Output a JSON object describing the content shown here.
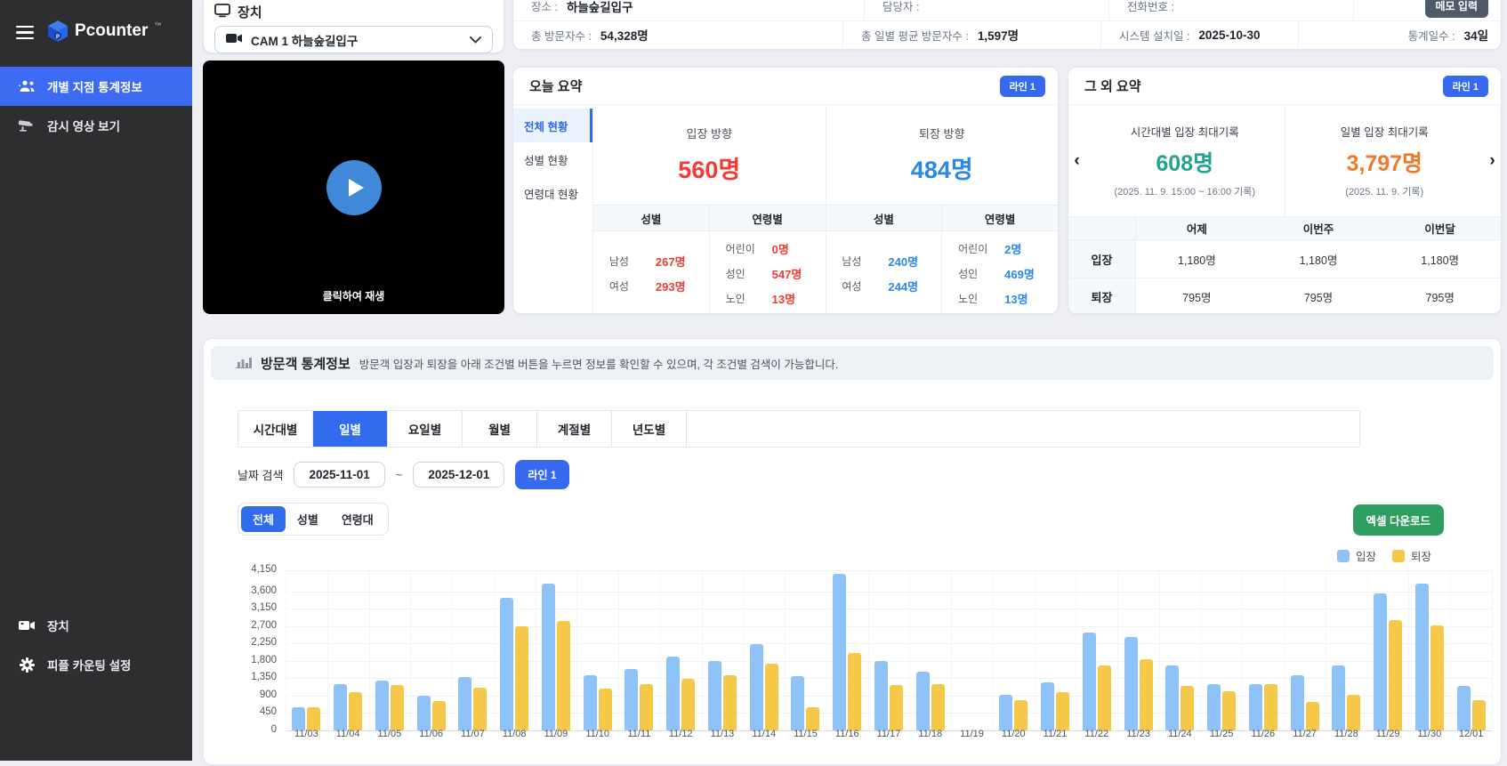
{
  "sidebar": {
    "logo": "Pcounter",
    "logo_tm": "™",
    "items": [
      {
        "label": "개별 지점 통계정보",
        "icon": "people-group-icon",
        "active": true
      },
      {
        "label": "감시 영상 보기",
        "icon": "cctv-camera-icon",
        "active": false
      }
    ],
    "bottom_items": [
      {
        "label": "장치",
        "icon": "video-camera-icon"
      },
      {
        "label": "피플 카운팅 설정",
        "icon": "gear-icon"
      }
    ]
  },
  "device": {
    "title": "장치",
    "selected": "CAM 1 하늘숲길입구"
  },
  "video": {
    "caption": "클릭하여 재생"
  },
  "info": {
    "row1": [
      {
        "label": "장소 :",
        "value": "하늘숲길입구"
      },
      {
        "label": "담당자 :",
        "value": ""
      },
      {
        "label": "전화번호 :",
        "value": ""
      }
    ],
    "memo_button": "메모 입력",
    "row2": [
      {
        "label": "총 방문자수 :",
        "value": "54,328명"
      },
      {
        "label": "총 일별 평균 방문자수 :",
        "value": "1,597명"
      },
      {
        "label": "시스템 설치일 :",
        "value": "2025-10-30"
      },
      {
        "label": "통계일수 :",
        "value": "34일"
      }
    ]
  },
  "today": {
    "title": "오늘 요약",
    "badge": "라인 1",
    "tabs": [
      "전체 현황",
      "성별 현황",
      "연령대 현황"
    ],
    "active_tab": "전체 현황",
    "entry": {
      "label": "입장 방향",
      "value": "560명"
    },
    "exit": {
      "label": "퇴장 방향",
      "value": "484명"
    },
    "col_headers": [
      "성별",
      "연령별",
      "성별",
      "연령별"
    ],
    "entry_gender": [
      {
        "label": "남성",
        "value": "267명"
      },
      {
        "label": "여성",
        "value": "293명"
      }
    ],
    "entry_age": [
      {
        "label": "어린이",
        "value": "0명"
      },
      {
        "label": "성인",
        "value": "547명"
      },
      {
        "label": "노인",
        "value": "13명"
      }
    ],
    "exit_gender": [
      {
        "label": "남성",
        "value": "240명"
      },
      {
        "label": "여성",
        "value": "244명"
      }
    ],
    "exit_age": [
      {
        "label": "어린이",
        "value": "2명"
      },
      {
        "label": "성인",
        "value": "469명"
      },
      {
        "label": "노인",
        "value": "13명"
      }
    ]
  },
  "other": {
    "title": "그 외 요약",
    "badge": "라인 1",
    "prev": "‹",
    "next": "›",
    "cards": [
      {
        "label": "시간대별 입장 최대기록",
        "value": "608명",
        "note": "(2025. 11. 9. 15:00 ~ 16:00 기록)",
        "color": "#22a390"
      },
      {
        "label": "일별 입장 최대기록",
        "value": "3,797명",
        "note": "(2025. 11. 9. 기록)",
        "color": "#f0782a"
      }
    ],
    "table": {
      "headers": [
        "어제",
        "이번주",
        "이번달"
      ],
      "rows": [
        {
          "label": "입장",
          "values": [
            "1,180명",
            "1,180명",
            "1,180명"
          ]
        },
        {
          "label": "퇴장",
          "values": [
            "795명",
            "795명",
            "795명"
          ]
        }
      ]
    }
  },
  "stats": {
    "title": "방문객 통계정보",
    "desc": "방문객 입장과 퇴장을 아래 조건별 버튼을 누르면 정보를 확인할 수 있으며, 각 조건별 검색이 가능합니다.",
    "tabs": [
      "시간대별",
      "일별",
      "요일별",
      "월별",
      "계절별",
      "년도별"
    ],
    "active_tab": "일별",
    "date_label": "날짜 검색",
    "date_from": "2025-11-01",
    "date_tilde": "~",
    "date_to": "2025-12-01",
    "line_button": "라인 1",
    "filters": [
      "전체",
      "성별",
      "연령대"
    ],
    "active_filter": "전체",
    "excel_button": "엑셀 다운로드"
  },
  "chart_data": {
    "type": "bar",
    "title": "",
    "xlabel": "",
    "ylabel": "",
    "categories": [
      "11/03",
      "11/04",
      "11/05",
      "11/06",
      "11/07",
      "11/08",
      "11/09",
      "11/10",
      "11/11",
      "11/12",
      "11/13",
      "11/14",
      "11/15",
      "11/16",
      "11/17",
      "11/18",
      "11/19",
      "11/20",
      "11/21",
      "11/22",
      "11/23",
      "11/24",
      "11/25",
      "11/26",
      "11/27",
      "11/28",
      "11/29",
      "11/30",
      "12/01"
    ],
    "series": [
      {
        "name": "입장",
        "color": "#8fc3f8",
        "values": [
          590,
          1190,
          1290,
          910,
          1380,
          3430,
          3797,
          1420,
          1580,
          1920,
          1800,
          2240,
          1410,
          4050,
          1800,
          1530,
          0,
          925,
          1250,
          2540,
          2410,
          1685,
          1190,
          1210,
          1420,
          1680,
          3560,
          3810,
          1150
        ]
      },
      {
        "name": "퇴장",
        "color": "#f6c84a",
        "values": [
          610,
          985,
          1170,
          760,
          1100,
          2700,
          2840,
          1080,
          1210,
          1330,
          1440,
          1740,
          590,
          2000,
          1170,
          1190,
          0,
          780,
          985,
          1680,
          1835,
          1160,
          1010,
          1210,
          740,
          925,
          2850,
          2710,
          780
        ]
      }
    ],
    "ylim": [
      0,
      4150
    ],
    "yticks": [
      0,
      450,
      900,
      1350,
      1800,
      2250,
      2700,
      3150,
      3600,
      4150
    ],
    "grid": true,
    "legend_position": "top-right"
  },
  "colors": {
    "accent_blue": "#2f6bec",
    "badge_blue": "#3569f0",
    "entry_red": "#f03b36",
    "exit_blue": "#2b87e8",
    "record_teal": "#22a390",
    "record_orange": "#f0782a",
    "excel_green": "#2e9e5f",
    "bar_entry": "#8fc3f8",
    "bar_exit": "#f6c84a",
    "sidebar_bg": "#2e2e31"
  }
}
